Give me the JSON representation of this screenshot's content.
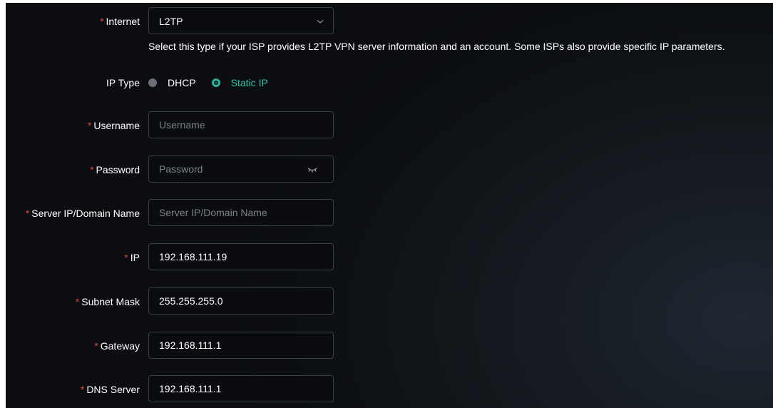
{
  "form": {
    "internet": {
      "label": "Internet",
      "required_mark": "*",
      "value": "L2TP",
      "hint": "Select this type if your ISP provides L2TP VPN server information and an account. Some ISPs also provide specific IP parameters."
    },
    "ip_type": {
      "label": "IP Type",
      "options": [
        "DHCP",
        "Static IP"
      ],
      "selected": "Static IP"
    },
    "username": {
      "label": "Username",
      "required_mark": "*",
      "placeholder": "Username",
      "value": ""
    },
    "password": {
      "label": "Password",
      "required_mark": "*",
      "placeholder": "Password",
      "value": "",
      "toggle_icon": "eye-closed-icon"
    },
    "server": {
      "label": "Server IP/Domain Name",
      "required_mark": "*",
      "placeholder": "Server IP/Domain Name",
      "value": ""
    },
    "ip": {
      "label": "IP",
      "required_mark": "*",
      "value": "192.168.111.19"
    },
    "subnet_mask": {
      "label": "Subnet Mask",
      "required_mark": "*",
      "value": "255.255.255.0"
    },
    "gateway": {
      "label": "Gateway",
      "required_mark": "*",
      "value": "192.168.111.1"
    },
    "dns_server": {
      "label": "DNS Server",
      "required_mark": "*",
      "value": "192.168.111.1"
    }
  },
  "colors": {
    "required": "#e2453c",
    "accent": "#26b39a",
    "text": "#ffffff",
    "placeholder": "#7b828b",
    "field_border": "#3a3f46"
  }
}
